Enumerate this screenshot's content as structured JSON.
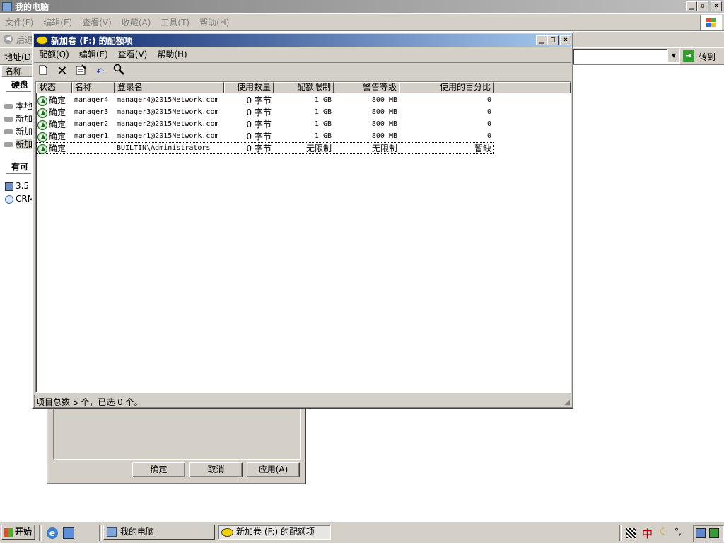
{
  "explorer": {
    "title": "我的电脑",
    "menu": [
      "文件(F)",
      "编辑(E)",
      "查看(V)",
      "收藏(A)",
      "工具(T)",
      "帮助(H)"
    ],
    "back_label": "后退",
    "address_label": "地址(D)",
    "go_label": "转到",
    "name_col": "名称",
    "section_hdd": "硬盘",
    "drives": [
      "本地",
      "新加",
      "新加",
      "新加"
    ],
    "section_removable": "有可",
    "removable": [
      "3.5",
      "CRM"
    ]
  },
  "props_dialog": {
    "ok": "确定",
    "cancel": "取消",
    "apply": "应用(A)"
  },
  "quota_window": {
    "title": "新加卷 (F:) 的配额项",
    "menu": [
      "配额(Q)",
      "编辑(E)",
      "查看(V)",
      "帮助(H)"
    ],
    "toolbar_icons": [
      "new-icon",
      "delete-icon",
      "properties-icon",
      "undo-icon",
      "find-icon"
    ],
    "columns": [
      "状态",
      "名称",
      "登录名",
      "使用数量",
      "配额限制",
      "警告等级",
      "使用的百分比"
    ],
    "rows": [
      {
        "status": "确定",
        "name": "manager4",
        "login": "manager4@2015Network.com",
        "used": "0 字节",
        "limit": "1 GB",
        "warn": "800 MB",
        "pct": "0"
      },
      {
        "status": "确定",
        "name": "manager3",
        "login": "manager3@2015Network.com",
        "used": "0 字节",
        "limit": "1 GB",
        "warn": "800 MB",
        "pct": "0"
      },
      {
        "status": "确定",
        "name": "manager2",
        "login": "manager2@2015Network.com",
        "used": "0 字节",
        "limit": "1 GB",
        "warn": "800 MB",
        "pct": "0"
      },
      {
        "status": "确定",
        "name": "manager1",
        "login": "manager1@2015Network.com",
        "used": "0 字节",
        "limit": "1 GB",
        "warn": "800 MB",
        "pct": "0"
      },
      {
        "status": "确定",
        "name": "",
        "login": "BUILTIN\\Administrators",
        "used": "0 字节",
        "limit": "无限制",
        "warn": "无限制",
        "pct": "暂缺"
      }
    ],
    "status_text": "项目总数 5 个，已选 0 个。"
  },
  "taskbar": {
    "start": "开始",
    "tasks": [
      "我的电脑",
      "新加卷 (F:) 的配额项"
    ],
    "tray_ime": "中",
    "tray_extra": "°,"
  }
}
